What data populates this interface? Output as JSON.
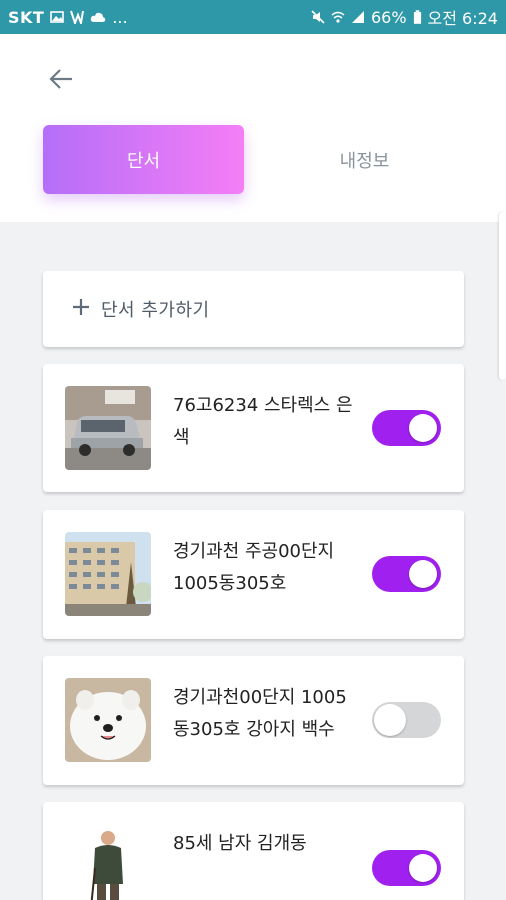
{
  "status_bar": {
    "carrier": "SKT",
    "extra": "...",
    "battery": "66%",
    "time": "오전 6:24"
  },
  "header": {
    "tabs": [
      {
        "label": "단서",
        "active": true
      },
      {
        "label": "내정보",
        "active": false
      }
    ]
  },
  "add_card": {
    "label": "단서 추가하기"
  },
  "items": [
    {
      "text": "76고6234 스타렉스 은색",
      "toggle_on": true,
      "image": "car-photo"
    },
    {
      "text": "경기과천 주공00단지 1005동305호",
      "toggle_on": true,
      "image": "apartment-photo"
    },
    {
      "text": "경기과천00단지 1005동305호 강아지 백수",
      "toggle_on": false,
      "image": "dog-photo"
    },
    {
      "text": "85세 남자 김개동",
      "toggle_on": true,
      "image": "elderly-man-photo"
    }
  ],
  "colors": {
    "status_bar": "#2f98a8",
    "accent_toggle": "#a020f0",
    "tab_gradient_start": "#b56ef8",
    "tab_gradient_end": "#f57ef6"
  }
}
